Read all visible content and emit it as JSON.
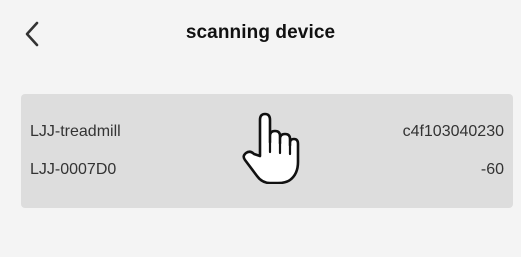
{
  "header": {
    "back_icon": "chevron-left-icon",
    "title": "scanning device"
  },
  "device_list": {
    "devices": [
      {
        "name": "LJJ-treadmill",
        "value": "c4f103040230"
      },
      {
        "name": "LJJ-0007D0",
        "value": "-60"
      }
    ]
  },
  "cursor": {
    "icon": "hand-pointer-icon"
  },
  "colors": {
    "background": "#f4f4f4",
    "card": "#dddddd",
    "text": "#333333",
    "title": "#111111"
  }
}
